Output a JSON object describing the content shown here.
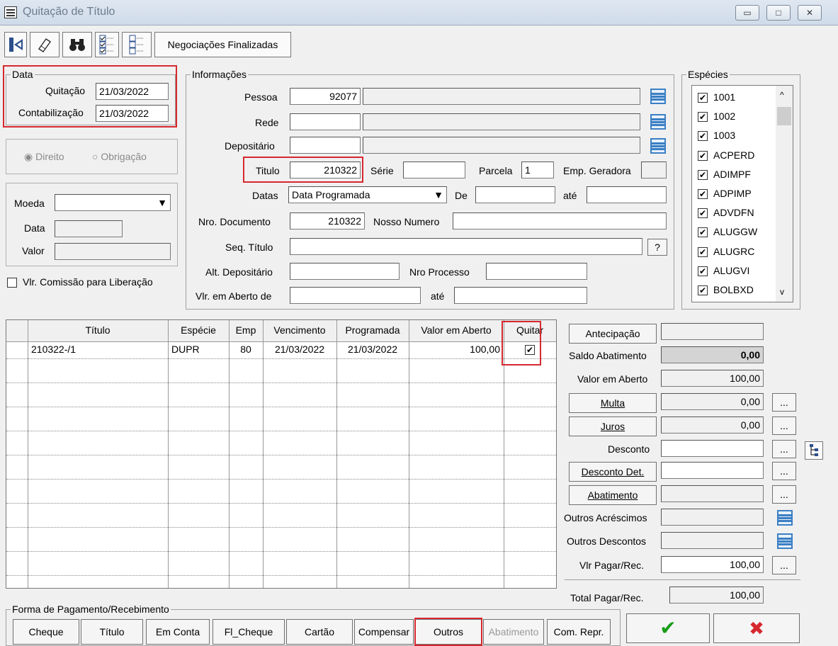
{
  "window": {
    "title": "Quitação de Título",
    "minimize": "▭",
    "maximize": "□",
    "close": "✕"
  },
  "toolbar": {
    "negociacoes": "Negociações Finalizadas"
  },
  "data_group": {
    "legend": "Data",
    "quitacao_label": "Quitação",
    "quitacao_value": "21/03/2022",
    "contab_label": "Contabilização",
    "contab_value": "21/03/2022"
  },
  "direito_obrigacao": {
    "direito": "Direito",
    "obrigacao": "Obrigação"
  },
  "moeda_group": {
    "moeda_label": "Moeda",
    "data_label": "Data",
    "valor_label": "Valor"
  },
  "vlr_comissao": "Vlr. Comissão para Liberação",
  "informacoes": {
    "legend": "Informações",
    "pessoa_label": "Pessoa",
    "pessoa_value": "92077",
    "rede_label": "Rede",
    "depositario_label": "Depositário",
    "titulo_label": "Titulo",
    "titulo_value": "210322",
    "serie_label": "Série",
    "parcela_label": "Parcela",
    "parcela_value": "1",
    "emp_geradora_label": "Emp. Geradora",
    "datas_label": "Datas",
    "datas_value": "Data Programada",
    "de_label": "De",
    "ate_label": "até",
    "nro_doc_label": "Nro. Documento",
    "nro_doc_value": "210322",
    "nosso_numero_label": "Nosso Numero",
    "seq_titulo_label": "Seq. Título",
    "seq_btn": "?",
    "alt_dep_label": "Alt. Depositário",
    "nro_processo_label": "Nro Processo",
    "vlr_aberto_label": "Vlr. em Aberto de",
    "vlr_ate_label": "até"
  },
  "especies": {
    "legend": "Espécies",
    "items": [
      "1001",
      "1002",
      "1003",
      "ACPERD",
      "ADIMPF",
      "ADPIMP",
      "ADVDFN",
      "ALUGGW",
      "ALUGRC",
      "ALUGVI",
      "BOLBXD"
    ]
  },
  "grid": {
    "columns": [
      "Título",
      "Espécie",
      "Emp",
      "Vencimento",
      "Programada",
      "Valor em Aberto",
      "Quitar"
    ],
    "rows": [
      {
        "titulo": "210322-/1",
        "especie": "DUPR",
        "emp": "80",
        "vencimento": "21/03/2022",
        "programada": "21/03/2022",
        "valor": "100,00",
        "quitar": "✔"
      }
    ]
  },
  "valores": {
    "antecipacao": "Antecipação",
    "saldo_abatimento_label": "Saldo Abatimento",
    "saldo_abatimento_value": "0,00",
    "valor_aberto_label": "Valor em Aberto",
    "valor_aberto_value": "100,00",
    "multa": "Multa",
    "multa_value": "0,00",
    "juros": "Juros",
    "juros_value": "0,00",
    "desconto_label": "Desconto",
    "desconto_det": "Desconto Det.",
    "abatimento": "Abatimento",
    "outros_acrescimos_label": "Outros Acréscimos",
    "outros_descontos_label": "Outros Descontos",
    "vlr_pagar_label": "Vlr Pagar/Rec.",
    "vlr_pagar_value": "100,00",
    "total_label": "Total Pagar/Rec.",
    "total_value": "100,00",
    "dots": "..."
  },
  "forma_pagamento": {
    "legend": "Forma de Pagamento/Recebimento",
    "buttons": [
      "Cheque",
      "Título",
      "Em Conta",
      "Fl_Cheque",
      "Cartão",
      "Compensar",
      "Outros",
      "Abatimento",
      "Com. Repr."
    ]
  },
  "actions": {
    "ok": "✔",
    "cancel": "✖"
  }
}
